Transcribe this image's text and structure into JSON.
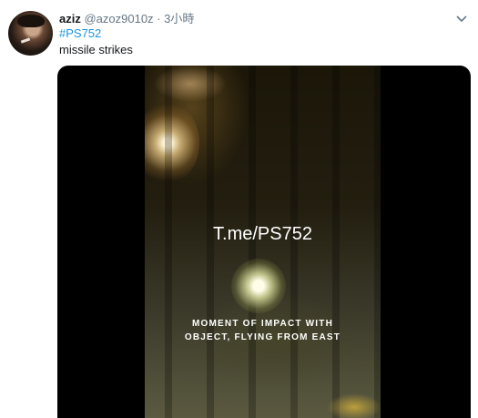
{
  "tweet": {
    "display_name": "aziz",
    "handle": "@azoz9010z",
    "separator": "·",
    "time": "3小時",
    "hashtag": "#PS752",
    "text": "missile strikes"
  },
  "media": {
    "watermark": "T.me/PS752",
    "caption_line1": "MOMENT OF IMPACT WITH",
    "caption_line2": "OBJECT, FLYING FROM EAST"
  },
  "icons": {
    "caret": "chevron-down-icon"
  },
  "colors": {
    "link": "#1b95e0",
    "secondary_text": "#657786",
    "primary_text": "#14171a"
  }
}
